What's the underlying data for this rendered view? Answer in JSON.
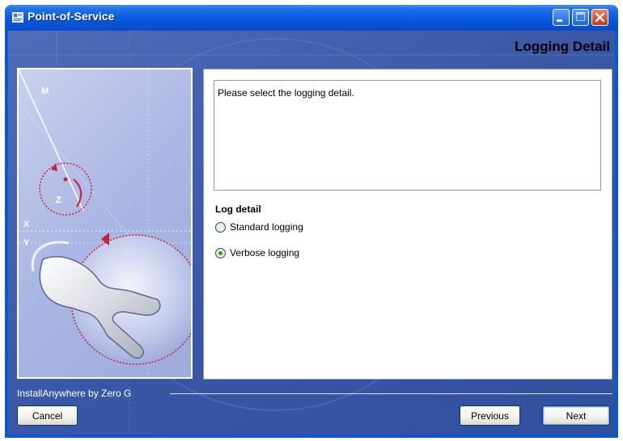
{
  "window": {
    "title": "Point-of-Service"
  },
  "header": {
    "page_title": "Logging Detail"
  },
  "content": {
    "message": "Please select the logging detail.",
    "log_detail": {
      "heading": "Log detail",
      "options": [
        {
          "label": "Standard logging",
          "selected": false
        },
        {
          "label": "Verbose logging",
          "selected": true
        }
      ]
    }
  },
  "art_labels": {
    "m": "M",
    "z": "Z",
    "x": "X",
    "y": "Y"
  },
  "footer": {
    "vendor": "InstallAnywhere by Zero G",
    "cancel_label": "Cancel",
    "previous_label": "Previous",
    "next_label": "Next"
  },
  "colors": {
    "titlebar": "#0a57d6",
    "client_bg": "#3a58a8",
    "radio_selected": "#21a121",
    "close_button": "#c43812"
  }
}
